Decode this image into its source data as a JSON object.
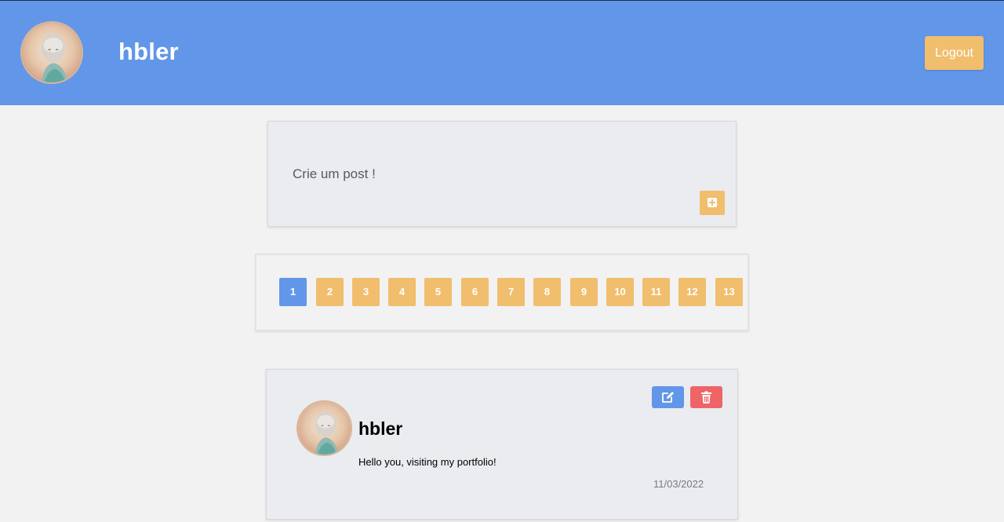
{
  "header": {
    "username": "hbler",
    "logout_label": "Logout"
  },
  "create_post": {
    "label": "Crie um post !",
    "add_icon": "plus-square-icon"
  },
  "pagination": {
    "active_page": "1",
    "pages": [
      "1",
      "2",
      "3",
      "4",
      "5",
      "6",
      "7",
      "8",
      "9",
      "10",
      "11",
      "12",
      "13"
    ]
  },
  "posts": [
    {
      "author": "hbler",
      "content": "Hello you, visiting my portfolio!",
      "date": "11/03/2022",
      "edit_icon": "edit-icon",
      "delete_icon": "trash-icon"
    }
  ],
  "colors": {
    "primary": "#6296e8",
    "accent": "#f0be6d",
    "danger": "#ef6467",
    "background": "#f2f2f2"
  }
}
